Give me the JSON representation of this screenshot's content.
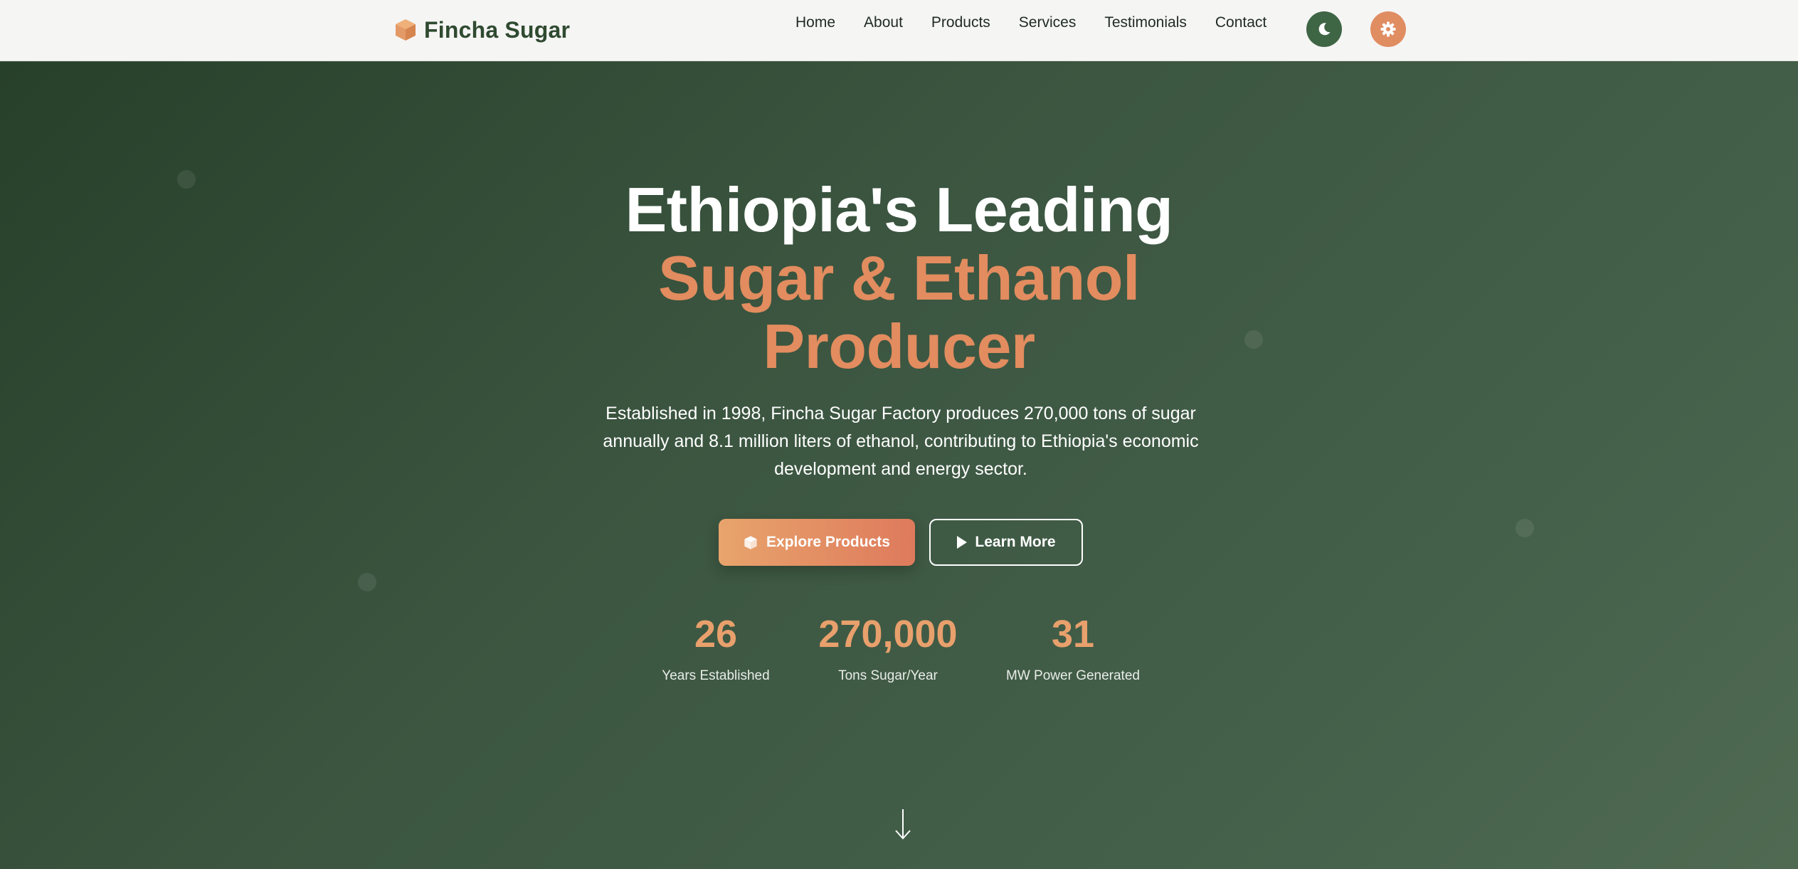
{
  "brand": {
    "name": "Fincha Sugar",
    "icon": "cube-icon"
  },
  "nav": {
    "links": [
      "Home",
      "About",
      "Products",
      "Services",
      "Testimonials",
      "Contact"
    ],
    "theme_toggle_icon": "moon-icon",
    "settings_icon": "gear-icon"
  },
  "hero": {
    "title_line1": "Ethiopia's Leading",
    "title_line2": "Sugar & Ethanol",
    "title_line3": "Producer",
    "description": "Established in 1998, Fincha Sugar Factory produces 270,000 tons of sugar annually and 8.1 million liters of ethanol, contributing to Ethiopia's economic development and energy sector.",
    "primary_button": "Explore Products",
    "primary_button_icon": "cube-icon",
    "secondary_button": "Learn More",
    "secondary_button_icon": "play-icon",
    "scroll_icon": "arrow-down-icon"
  },
  "stats": [
    {
      "value": "26",
      "label": "Years Established"
    },
    {
      "value": "270,000",
      "label": "Tons Sugar/Year"
    },
    {
      "value": "31",
      "label": "MW Power Generated"
    }
  ],
  "colors": {
    "brand_green": "#2f4a30",
    "accent_orange": "#e28c5f",
    "moon_button": "#3e6544",
    "gear_button": "#e08d62"
  }
}
